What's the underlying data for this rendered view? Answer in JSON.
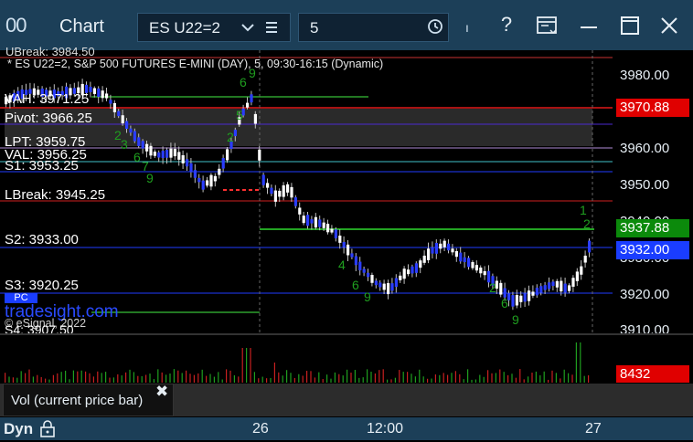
{
  "window": {
    "title": "Chart",
    "app_icon": "00",
    "icons": [
      "symbol-dropdown-icon",
      "list-icon",
      "clock-icon",
      "help-icon",
      "layout-icon",
      "minimize-icon",
      "maximize-icon",
      "close-icon"
    ]
  },
  "toolbar": {
    "symbol": "ES U22=2",
    "interval": "5",
    "help": "?",
    "mark": "ı"
  },
  "chart": {
    "header": "* ES U22=2, S&P 500 FUTURES E-MINI (DAY), 5, 09:30-16:15 (Dynamic)",
    "levels": {
      "ubreak": "UBreak: 3984.50",
      "vah": "VAH: 3971.25",
      "pivot": "Pivot: 3966.25",
      "lpt": "LPT: 3959.75",
      "val": "VAL: 3956.25",
      "s1": "S1: 3953.25",
      "lbreak": "LBreak: 3945.25",
      "s2": "S2: 3933.00",
      "s3": "S3: 3920.25",
      "s4": "S4: 3907.50",
      "pc": "PC"
    },
    "watermark": "tradesight.com",
    "copyright": "© eSignal, 2022",
    "price_axis": [
      "3980.00",
      "3970.00",
      "3960.00",
      "3950.00",
      "3940.00",
      "3930.00",
      "3920.00",
      "3910.00"
    ],
    "price_tags": {
      "red": "3970.88",
      "green": "3937.88",
      "blue": "3932.00"
    },
    "colors": {
      "up_bar": "#ffffff",
      "down_bar": "#2a3dff",
      "count_label": "#1f9e1f",
      "tag_red": "#e00000",
      "tag_green": "#0b8a0b",
      "tag_blue": "#1a3dff"
    }
  },
  "volume": {
    "study": "Vol (current price bar)",
    "value": "8432",
    "close": "✖"
  },
  "time_axis": {
    "mode": "Dyn",
    "labels": [
      "26",
      "12:00",
      "27"
    ]
  }
}
